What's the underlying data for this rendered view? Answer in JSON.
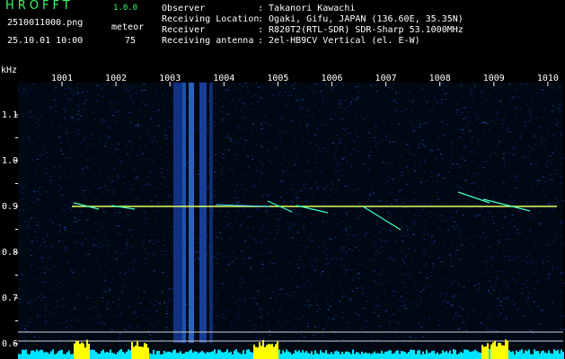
{
  "app": {
    "title": "HROFFT",
    "version": "1.0.0"
  },
  "file_name": "2510011000.png",
  "datetime": "25.10.01 10:00",
  "meteor": {
    "label": "meteor",
    "count": "75"
  },
  "meta": [
    {
      "key": "Observer",
      "value": ": Takanori Kawachi"
    },
    {
      "key": "Receiving Location",
      "value": ": Ogaki, Gifu, JAPAN (136.60E, 35.35N)"
    },
    {
      "key": "Receiver",
      "value": ": R820T2(RTL-SDR) SDR-Sharp 53.1000MHz"
    },
    {
      "key": "Receiving antenna",
      "value": ": 2el-HB9CV Vertical (el. E-W)"
    }
  ],
  "axis": {
    "unit": "kHz",
    "time_ticks": [
      "1001",
      "1002",
      "1003",
      "1004",
      "1005",
      "1006",
      "1007",
      "1008",
      "1009",
      "1010"
    ],
    "freq_ticks": [
      "1.1",
      "1.0",
      "0.9",
      "0.8",
      "0.7",
      "0.6"
    ]
  },
  "colors": {
    "background": "#000000",
    "title": "#33ff66",
    "carrier": "#e0ff60",
    "histogram_bar": "#00e5ff",
    "histogram_peak": "#ffff00",
    "axis": "#ffffff"
  }
}
